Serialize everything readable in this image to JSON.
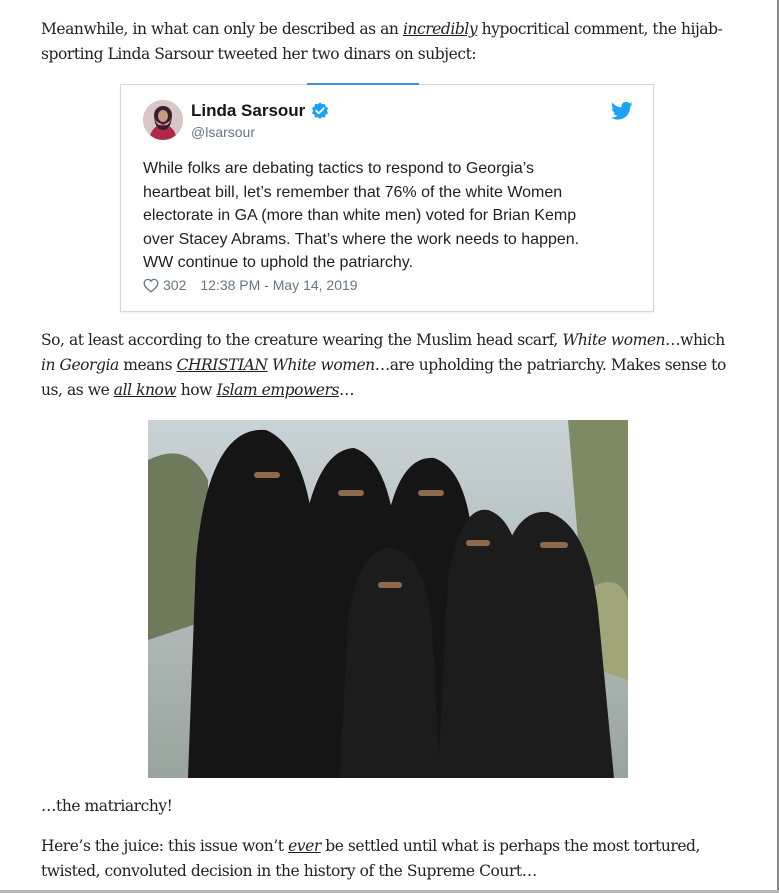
{
  "paragraph1": {
    "line1_a": "Meanwhile, in what can only be described as an ",
    "line1_link": "incredibly",
    "line1_b": " hypocritical comment, the hijab-",
    "line2": "sporting Linda Sarsour tweeted her two dinars on subject:"
  },
  "tweet": {
    "author_name": "Linda Sarsour",
    "handle": "@lsarsour",
    "text_lines": [
      "While folks are debating tactics to respond to Georgia’s",
      "heartbeat bill, let’s remember that 76% of the white Women",
      "electorate in GA (more than white men) voted for Brian Kemp",
      "over Stacey Abrams. That’s where the work needs to happen.",
      "WW continue to uphold the patriarchy."
    ],
    "likes": "302",
    "timestamp": "12:38 PM - May 14, 2019",
    "avatar_icon": "profile-photo",
    "verified_icon": "verified-badge-icon",
    "bird_icon": "twitter-bird-icon",
    "accent_color": "#1da1f2"
  },
  "paragraph2": {
    "l1_a": "So, at least according to the creature wearing the Muslim head scarf, ",
    "l1_em": "White women",
    "l1_b": "…which",
    "l2_em1": "in Georgia",
    "l2_a": " means ",
    "l2_link": "CHRISTIAN",
    "l2_em2": " White women",
    "l2_b": "…are upholding the patriarchy.  Makes sense to",
    "l3_a": "us, as we ",
    "l3_link1": "all know",
    "l3_b": " how ",
    "l3_link2": "Islam empowers",
    "l3_c": "…"
  },
  "photo": {
    "subject": "women-in-niqab-photo"
  },
  "paragraph3": {
    "text": "…the matriarchy!"
  },
  "paragraph4": {
    "l1_a": "Here’s the juice: this issue won’t ",
    "l1_link": "ever",
    "l1_b": " be settled until what is perhaps the most tortured,",
    "l2": "twisted, convoluted decision in the history of the Supreme Court…"
  }
}
